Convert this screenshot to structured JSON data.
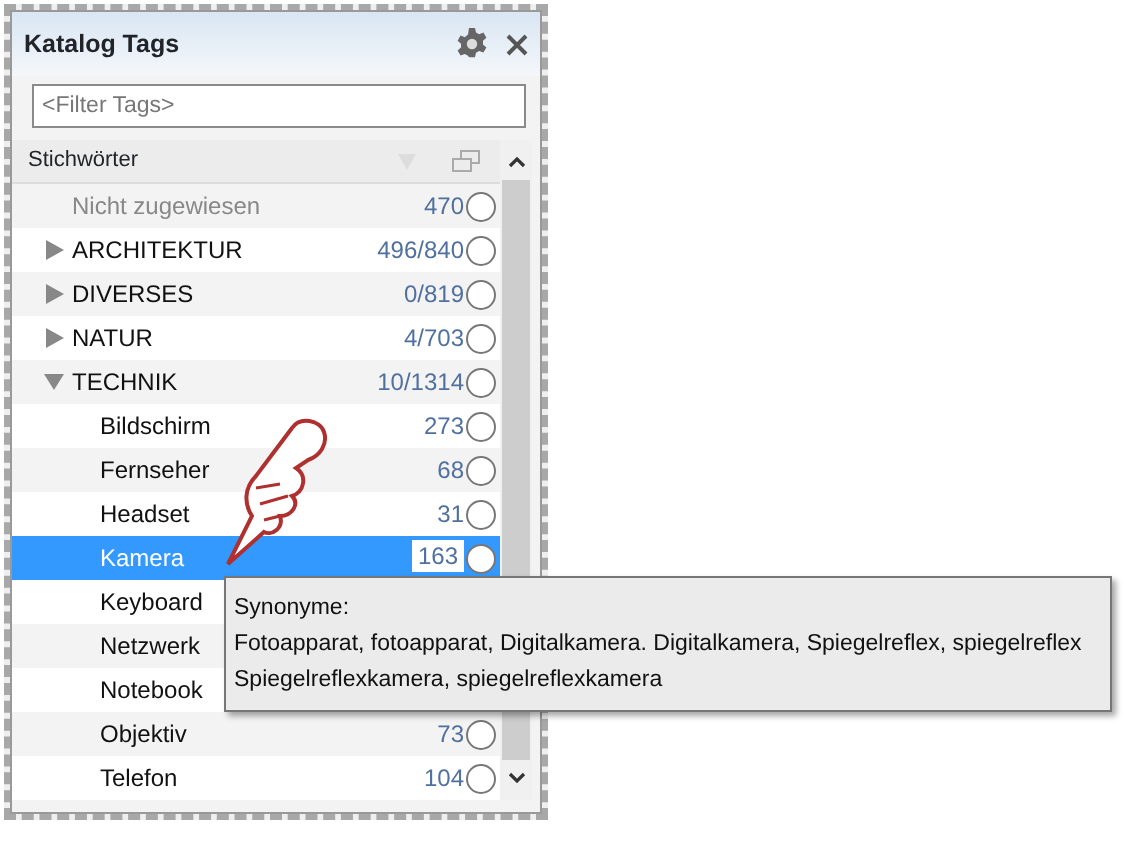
{
  "panel": {
    "title": "Katalog Tags",
    "filter": {
      "placeholder": "<Filter Tags>"
    },
    "column_header": "Stichwörter"
  },
  "tags": [
    {
      "kind": "unassigned",
      "label": "Nicht zugewiesen",
      "count": "470",
      "selected": false
    },
    {
      "kind": "group",
      "label": "ARCHITEKTUR",
      "count": "496/840",
      "expanded": false,
      "selected": false
    },
    {
      "kind": "group",
      "label": "DIVERSES",
      "count": "0/819",
      "expanded": false,
      "selected": false
    },
    {
      "kind": "group",
      "label": "NATUR",
      "count": "4/703",
      "expanded": false,
      "selected": false
    },
    {
      "kind": "group",
      "label": "TECHNIK",
      "count": "10/1314",
      "expanded": true,
      "selected": false,
      "children": [
        {
          "kind": "tag",
          "label": "Bildschirm",
          "count": "273",
          "selected": false
        },
        {
          "kind": "tag",
          "label": "Fernseher",
          "count": "68",
          "selected": false
        },
        {
          "kind": "tag",
          "label": "Headset",
          "count": "31",
          "selected": false
        },
        {
          "kind": "tag",
          "label": "Kamera",
          "count": "163",
          "selected": true
        },
        {
          "kind": "tag",
          "label": "Keyboard",
          "selected": false
        },
        {
          "kind": "tag",
          "label": "Netzwerk",
          "selected": false
        },
        {
          "kind": "tag",
          "label": "Notebook",
          "selected": false
        },
        {
          "kind": "tag",
          "label": "Objektiv",
          "count": "73",
          "selected": false
        },
        {
          "kind": "tag",
          "label": "Telefon",
          "count": "104",
          "selected": false
        }
      ]
    }
  ],
  "tooltip": {
    "heading": "Synonyme:",
    "lines": [
      "Fotoapparat, fotoapparat, Digitalkamera. Digitalkamera, Spiegelreflex, spiegelreflex",
      "Spiegelreflexkamera, spiegelreflexkamera"
    ]
  }
}
